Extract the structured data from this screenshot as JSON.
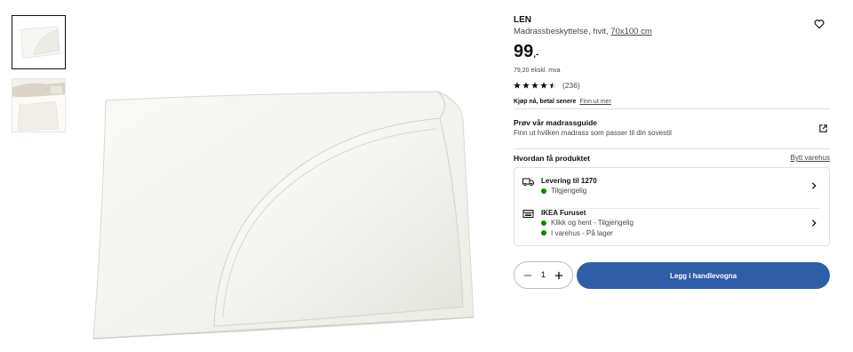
{
  "gallery": {
    "thumbnails": [
      {
        "alt": "white-mattress-protector-folded",
        "selected": true
      },
      {
        "alt": "mattress-protector-on-bed",
        "selected": false
      }
    ]
  },
  "product": {
    "name": "LEN",
    "description": "Madrassbeskyttelse, hvit,",
    "size": "70x100 cm",
    "price": "99",
    "price_suffix": ",-",
    "price_ex_vat": "79,20 ekskl. mva",
    "rating": 4.5,
    "review_count": "(236)",
    "buy_now_label": "Kjøp nå, betal senere",
    "buy_now_link": "Finn ut mer"
  },
  "guide": {
    "title": "Prøv vår madrassguide",
    "subtitle": "Finn ut hvilken madrass som passer til din sovestil"
  },
  "availability": {
    "title": "Hvordan få produktet",
    "change_store_link": "Bytt varehus",
    "delivery": {
      "title": "Levering til 1270",
      "status": "Tilgjengelig"
    },
    "store": {
      "title": "IKEA Furuset",
      "status_click_collect": "Klikk og hent - Tilgjengelig",
      "status_in_store": "I varehus - På lager"
    },
    "status_color": "#0a8a00"
  },
  "cart": {
    "quantity": "1",
    "add_label": "Legg i handlevogna",
    "button_color": "#2f5da8"
  }
}
